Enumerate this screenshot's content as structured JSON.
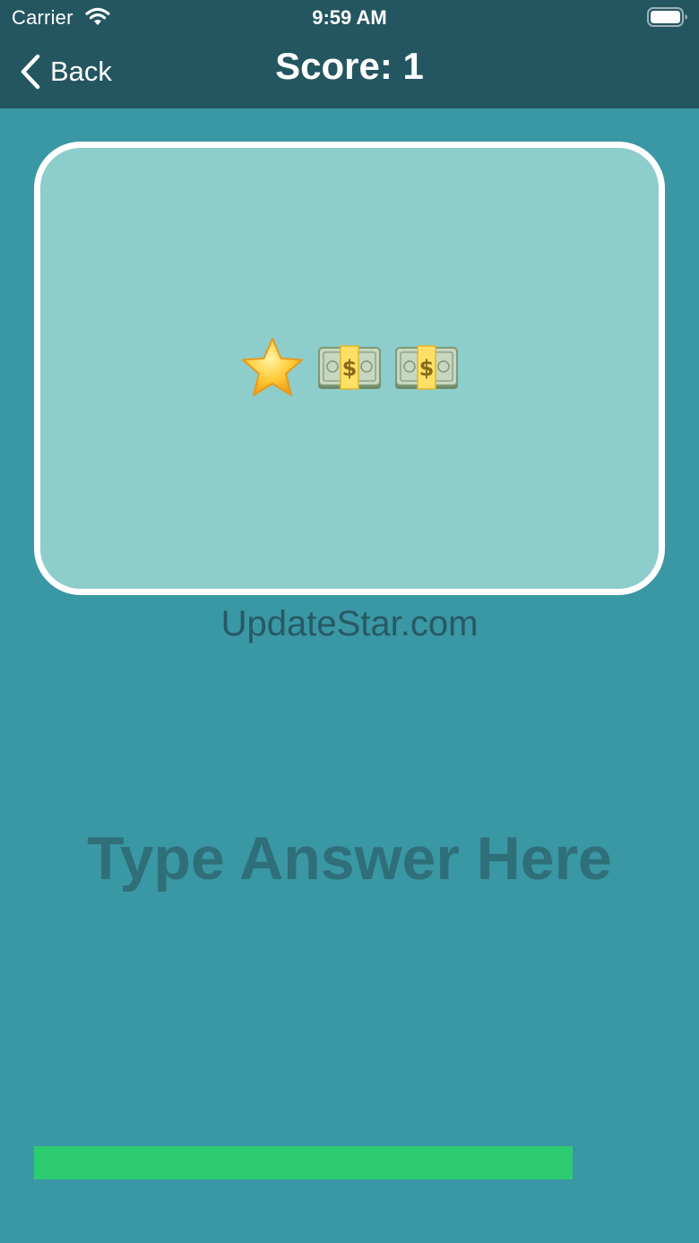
{
  "status_bar": {
    "carrier": "Carrier",
    "time": "9:59 AM",
    "wifi_icon": "wifi-icon",
    "battery_icon": "battery-full-icon"
  },
  "nav": {
    "back_label": "Back",
    "back_icon": "chevron-left-icon",
    "title": "Score: 1"
  },
  "puzzle": {
    "emojis": [
      "star-emoji",
      "money-bill-emoji",
      "money-bill-emoji"
    ]
  },
  "watermark": "UpdateStar.com",
  "answer": {
    "value": "",
    "placeholder": "Type Answer Here"
  },
  "progress": {
    "fraction": 0.853
  },
  "colors": {
    "background": "#3a97a4",
    "nav_bar": "#235661",
    "card_fill": "#8dcdcc",
    "card_border": "#ffffff",
    "progress_fill": "#2ecc71",
    "placeholder_text": "#2f6f79"
  }
}
